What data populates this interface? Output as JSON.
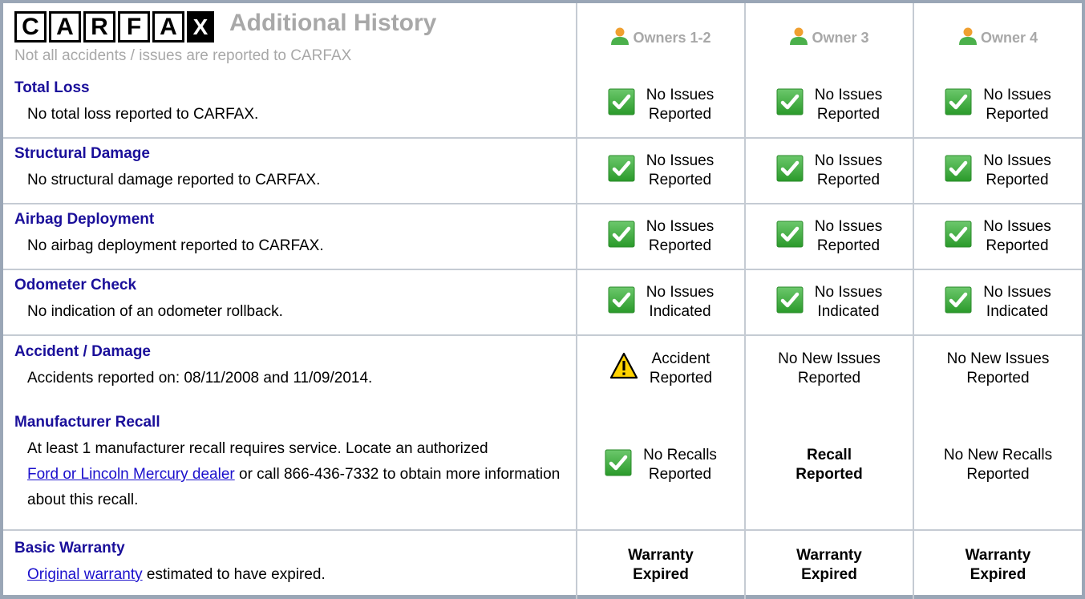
{
  "header": {
    "logo_letters": [
      "C",
      "A",
      "R",
      "F",
      "A",
      "X"
    ],
    "title": "Additional History",
    "subtitle": "Not all accidents / issues are reported to CARFAX",
    "owners": [
      "Owners 1-2",
      "Owner 3",
      "Owner 4"
    ]
  },
  "rows": [
    {
      "title": "Total Loss",
      "desc": "No total loss reported to CARFAX.",
      "cells": [
        {
          "icon": "check",
          "line1": "No Issues",
          "line2": "Reported"
        },
        {
          "icon": "check",
          "line1": "No Issues",
          "line2": "Reported"
        },
        {
          "icon": "check",
          "line1": "No Issues",
          "line2": "Reported"
        }
      ]
    },
    {
      "title": "Structural Damage",
      "desc": "No structural damage reported to CARFAX.",
      "cells": [
        {
          "icon": "check",
          "line1": "No Issues",
          "line2": "Reported"
        },
        {
          "icon": "check",
          "line1": "No Issues",
          "line2": "Reported"
        },
        {
          "icon": "check",
          "line1": "No Issues",
          "line2": "Reported"
        }
      ]
    },
    {
      "title": "Airbag Deployment",
      "desc": "No airbag deployment reported to CARFAX.",
      "cells": [
        {
          "icon": "check",
          "line1": "No Issues",
          "line2": "Reported"
        },
        {
          "icon": "check",
          "line1": "No Issues",
          "line2": "Reported"
        },
        {
          "icon": "check",
          "line1": "No Issues",
          "line2": "Reported"
        }
      ]
    },
    {
      "title": "Odometer Check",
      "desc": "No indication of an odometer rollback.",
      "cells": [
        {
          "icon": "check",
          "line1": "No Issues",
          "line2": "Indicated"
        },
        {
          "icon": "check",
          "line1": "No Issues",
          "line2": "Indicated"
        },
        {
          "icon": "check",
          "line1": "No Issues",
          "line2": "Indicated"
        }
      ]
    },
    {
      "title": "Accident / Damage",
      "desc": "Accidents reported on: 08/11/2008 and 11/09/2014.",
      "cells": [
        {
          "icon": "warning",
          "line1": "Accident",
          "line2": "Reported"
        },
        {
          "icon": "",
          "line1": "No New Issues",
          "line2": "Reported"
        },
        {
          "icon": "",
          "line1": "No New Issues",
          "line2": "Reported"
        }
      ]
    }
  ],
  "recall": {
    "title": "Manufacturer Recall",
    "desc_part1": "At least 1 manufacturer recall requires service. Locate an authorized",
    "link": "Ford or Lincoln Mercury dealer",
    "desc_part2": " or call 866-436-7332 to obtain more information about this recall.",
    "cells": [
      {
        "icon": "check",
        "line1": "No Recalls",
        "line2": "Reported",
        "bold": false
      },
      {
        "icon": "",
        "line1": "Recall",
        "line2": "Reported",
        "bold": true
      },
      {
        "icon": "",
        "line1": "No New Recalls",
        "line2": "Reported",
        "bold": false
      }
    ]
  },
  "warranty": {
    "title": "Basic Warranty",
    "link": "Original warranty",
    "desc": " estimated to have expired.",
    "cells": [
      {
        "line1": "Warranty",
        "line2": "Expired"
      },
      {
        "line1": "Warranty",
        "line2": "Expired"
      },
      {
        "line1": "Warranty",
        "line2": "Expired"
      }
    ]
  },
  "colors": {
    "title_blue": "#1a0f9a",
    "link_blue": "#1a0fcc",
    "header_gray": "#a8a8a8",
    "check_green": "#3aa53a",
    "frame": "#9aa6b6"
  }
}
